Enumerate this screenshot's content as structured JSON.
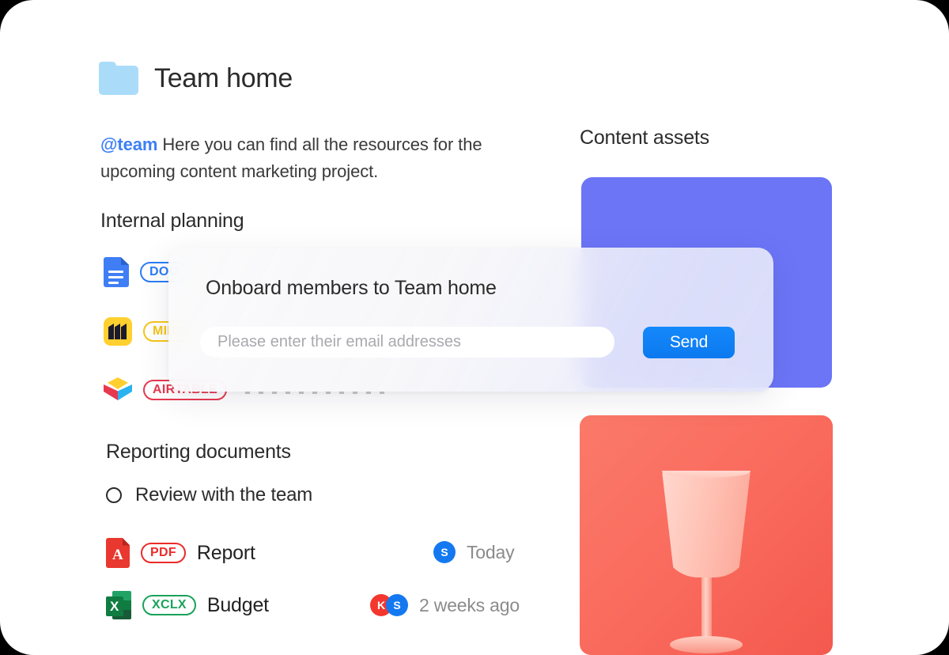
{
  "header": {
    "folder_icon": "folder-icon",
    "title": "Team home"
  },
  "intro": {
    "mention": "@team",
    "text": " Here you can find all the resources for the upcoming content marketing project."
  },
  "sections": {
    "internal_planning": "Internal planning",
    "reporting_documents": "Reporting documents",
    "content_assets": "Content assets"
  },
  "internal_files": [
    {
      "icon": "google-docs-icon",
      "badge": "DOC"
    },
    {
      "icon": "miro-icon",
      "badge": "MIRO"
    },
    {
      "icon": "airtable-icon",
      "badge": "AIRTABLE"
    }
  ],
  "task": {
    "checkbox_state": "unchecked",
    "label": "Review with the team"
  },
  "reporting_files": [
    {
      "icon": "pdf-icon",
      "badge": "PDF",
      "name": "Report",
      "avatars": [
        {
          "initial": "S",
          "color": "#1479f0"
        }
      ],
      "time": "Today"
    },
    {
      "icon": "excel-icon",
      "badge": "XCLX",
      "name": "Budget",
      "avatars": [
        {
          "initial": "K",
          "color": "#f4372e"
        },
        {
          "initial": "S",
          "color": "#1479f0"
        }
      ],
      "time": "2 weeks ago"
    }
  ],
  "assets": [
    {
      "name": "purple-asset-card",
      "color": "#6b75f6"
    },
    {
      "name": "coral-goblet-asset-card",
      "color": "#fa7468"
    }
  ],
  "modal": {
    "title": "Onboard members to Team home",
    "input_placeholder": "Please enter their email addresses",
    "input_value": "",
    "send_label": "Send",
    "send_color": "#0d7ff5"
  }
}
